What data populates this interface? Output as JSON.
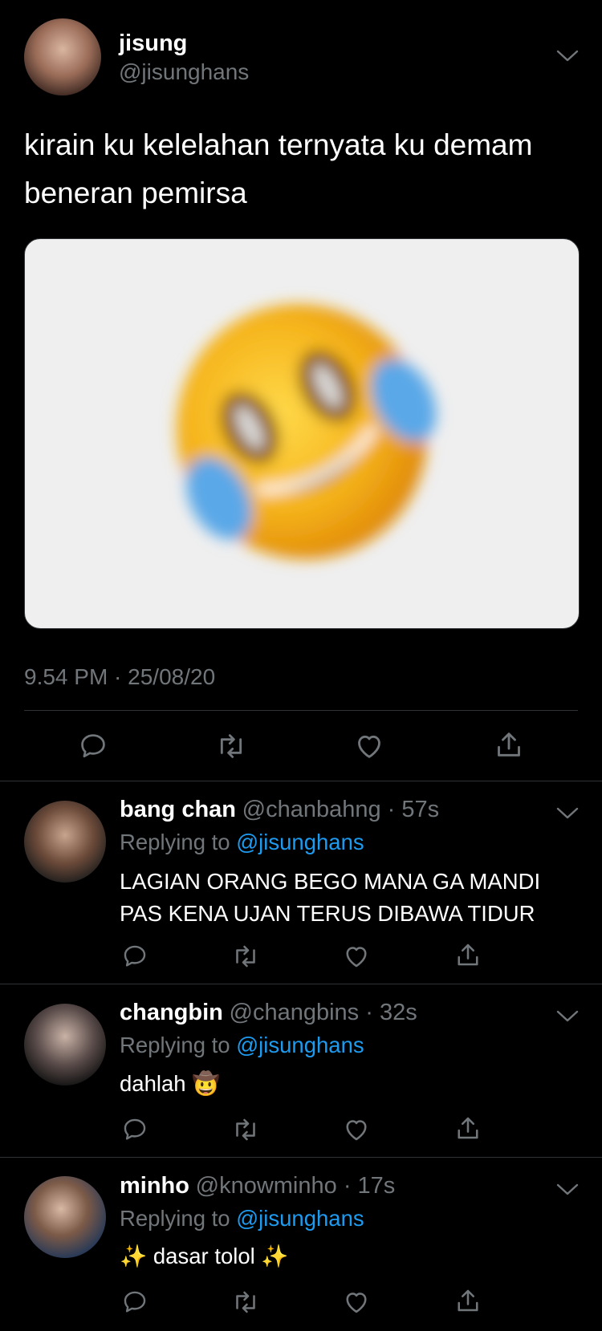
{
  "tweet": {
    "name": "jisung",
    "handle": "@jisunghans",
    "text_line1": "kirain ku kelelahan ternyata ku demam",
    "text_line2": "beneran pemirsa",
    "timestamp": "9.54 PM · 25/08/20",
    "media": "laughing-crying-emoji-image"
  },
  "replies": [
    {
      "name": "bang chan",
      "handle": "@chanbahng",
      "age": "57s",
      "replying_prefix": "Replying to",
      "replying_handle": "@jisunghans",
      "line1": "LAGIAN ORANG BEGO MANA GA MANDI",
      "line2": "PAS KENA UJAN TERUS DIBAWA TIDUR"
    },
    {
      "name": "changbin",
      "handle": "@changbins",
      "age": "32s",
      "replying_prefix": "Replying to",
      "replying_handle": "@jisunghans",
      "line1": "dahlah",
      "emoji": "🤠"
    },
    {
      "name": "minho",
      "handle": "@knowminho",
      "age": "17s",
      "replying_prefix": "Replying to",
      "replying_handle": "@jisunghans",
      "sparkle_left": "✨",
      "line1": "dasar tolol",
      "sparkle_right": "✨"
    }
  ],
  "colors": {
    "background": "#000000",
    "text": "#ffffff",
    "muted": "#71767b",
    "link": "#1d9bf0",
    "divider": "#2f3336"
  }
}
